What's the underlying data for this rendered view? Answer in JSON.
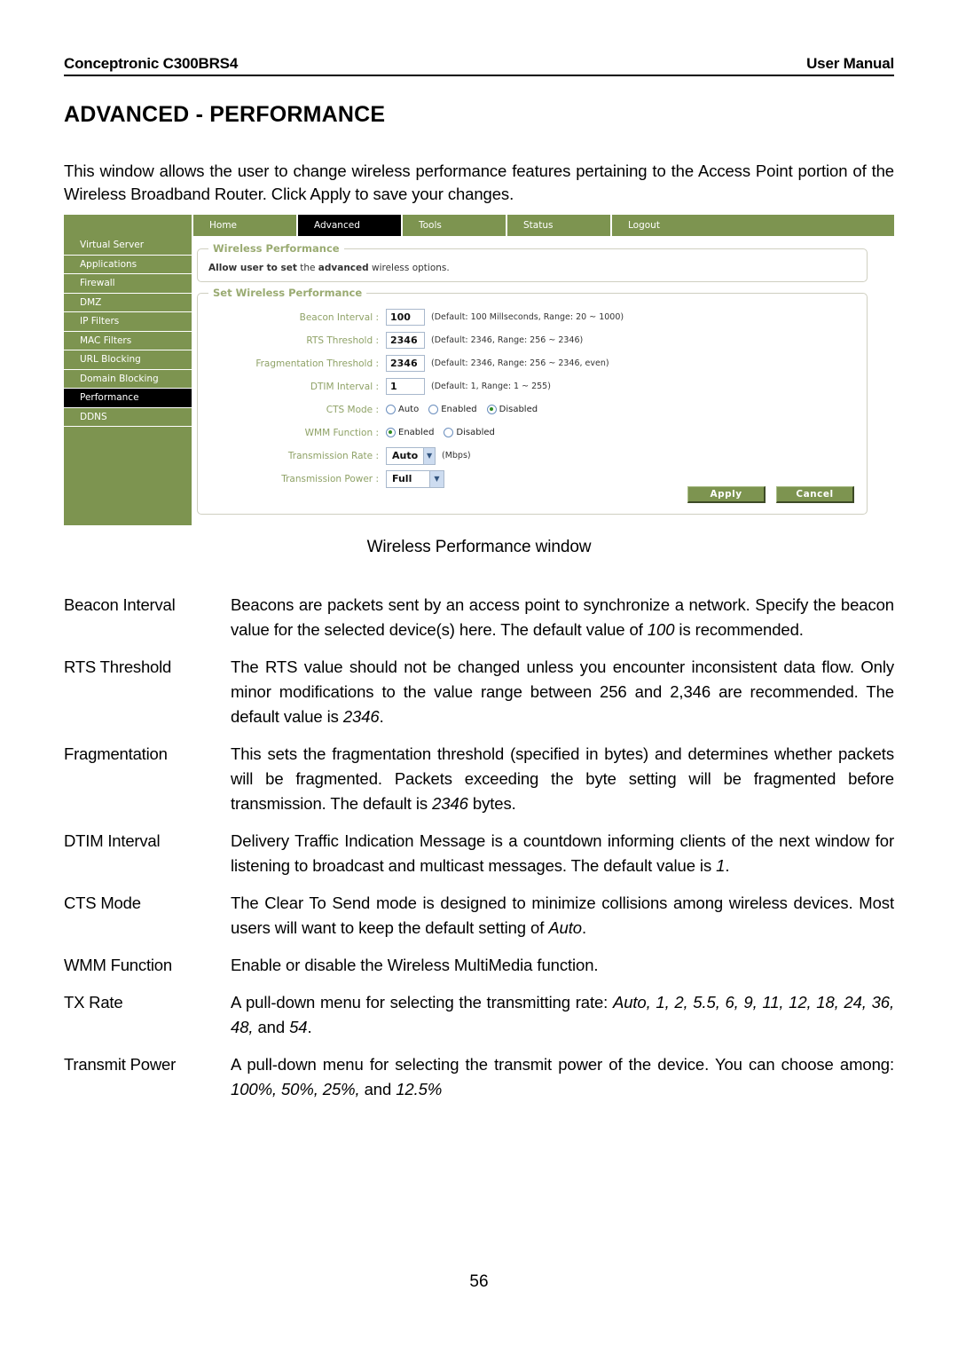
{
  "header": {
    "left": "Conceptronic C300BRS4",
    "right": "User Manual"
  },
  "section_title": "ADVANCED - PERFORMANCE",
  "intro": "This window allows the user to change wireless performance features pertaining to the Access Point portion of the Wireless Broadband Router. Click Apply to save your changes.",
  "screenshot": {
    "nav_tabs": [
      {
        "label": "Home",
        "active": false
      },
      {
        "label": "Advanced",
        "active": true
      },
      {
        "label": "Tools",
        "active": false
      },
      {
        "label": "Status",
        "active": false
      },
      {
        "label": "Logout",
        "active": false
      }
    ],
    "sidebar": [
      {
        "label": "Virtual Server",
        "active": false
      },
      {
        "label": "Applications",
        "active": false
      },
      {
        "label": "Firewall",
        "active": false
      },
      {
        "label": "DMZ",
        "active": false
      },
      {
        "label": "IP Filters",
        "active": false
      },
      {
        "label": "MAC Filters",
        "active": false
      },
      {
        "label": "URL Blocking",
        "active": false
      },
      {
        "label": "Domain Blocking",
        "active": false
      },
      {
        "label": "Performance",
        "active": true
      },
      {
        "label": "DDNS",
        "active": false
      }
    ],
    "panel_wireless": {
      "legend": "Wireless Performance",
      "description_bold_1": "Allow user to set",
      "description_normal_1": " the ",
      "description_bold_2": "advanced",
      "description_normal_2": " wireless options."
    },
    "panel_set": {
      "legend": "Set Wireless Performance",
      "fields": {
        "beacon_interval": {
          "label": "Beacon Interval :",
          "value": "100",
          "hint": "(Default: 100 Millseconds, Range: 20 ~ 1000)"
        },
        "rts_threshold": {
          "label": "RTS Threshold :",
          "value": "2346",
          "hint": "(Default: 2346, Range: 256 ~ 2346)"
        },
        "fragmentation_threshold": {
          "label": "Fragmentation Threshold :",
          "value": "2346",
          "hint": "(Default: 2346, Range: 256 ~ 2346, even)"
        },
        "dtim_interval": {
          "label": "DTIM Interval :",
          "value": "1",
          "hint": "(Default: 1, Range: 1 ~ 255)"
        },
        "cts_mode": {
          "label": "CTS Mode :",
          "options": [
            {
              "label": "Auto",
              "selected": false
            },
            {
              "label": "Enabled",
              "selected": false
            },
            {
              "label": "Disabled",
              "selected": true
            }
          ]
        },
        "wmm_function": {
          "label": "WMM Function :",
          "options": [
            {
              "label": "Enabled",
              "selected": true
            },
            {
              "label": "Disabled",
              "selected": false
            }
          ]
        },
        "transmission_rate": {
          "label": "Transmission Rate :",
          "value": "Auto",
          "unit": "(Mbps)"
        },
        "transmission_power": {
          "label": "Transmission Power :",
          "value": "Full"
        }
      },
      "apply_label": "Apply",
      "cancel_label": "Cancel"
    }
  },
  "caption": "Wireless Performance window",
  "definitions": [
    {
      "term": "Beacon Interval",
      "desc_parts": [
        {
          "text": "Beacons are packets sent by an access point to synchronize a network. Specify the beacon value for the selected device(s) here. The default value of ",
          "italic": false
        },
        {
          "text": "100",
          "italic": true
        },
        {
          "text": " is recommended.",
          "italic": false
        }
      ]
    },
    {
      "term": "RTS Threshold",
      "desc_parts": [
        {
          "text": "The RTS value should not be changed unless you encounter inconsistent data flow. Only minor modifications to the value range between 256 and 2,346 are recommended. The default value is ",
          "italic": false
        },
        {
          "text": "2346",
          "italic": true
        },
        {
          "text": ".",
          "italic": false
        }
      ]
    },
    {
      "term": "Fragmentation",
      "desc_parts": [
        {
          "text": "This sets the fragmentation threshold (specified in bytes) and determines whether packets will be fragmented. Packets exceeding the byte setting will be fragmented before transmission. The default is ",
          "italic": false
        },
        {
          "text": "2346",
          "italic": true
        },
        {
          "text": " bytes.",
          "italic": false
        }
      ]
    },
    {
      "term": "DTIM Interval",
      "desc_parts": [
        {
          "text": "Delivery Traffic Indication Message is a countdown informing clients of the next window for listening to broadcast and multicast messages. The default value is ",
          "italic": false
        },
        {
          "text": "1",
          "italic": true
        },
        {
          "text": ".",
          "italic": false
        }
      ]
    },
    {
      "term": "CTS Mode",
      "desc_parts": [
        {
          "text": "The Clear To Send mode is designed to minimize collisions among wireless devices. Most users will want to keep the default setting of ",
          "italic": false
        },
        {
          "text": "Auto",
          "italic": true
        },
        {
          "text": ".",
          "italic": false
        }
      ]
    },
    {
      "term": "WMM Function",
      "desc_parts": [
        {
          "text": "Enable or disable the Wireless MultiMedia function.",
          "italic": false
        }
      ]
    },
    {
      "term": "TX Rate",
      "desc_parts": [
        {
          "text": "A pull-down menu for selecting the transmitting rate:  ",
          "italic": false
        },
        {
          "text": "Auto, 1, 2, 5.5, 6, 9, 11, 12, 18, 24, 36, 48,",
          "italic": true
        },
        {
          "text": " and ",
          "italic": false
        },
        {
          "text": "54",
          "italic": true
        },
        {
          "text": ".",
          "italic": false
        }
      ]
    },
    {
      "term": "Transmit Power",
      "desc_parts": [
        {
          "text": "A pull-down menu for selecting the transmit power of the device. You can choose among: ",
          "italic": false
        },
        {
          "text": "100%, 50%, 25%,",
          "italic": true
        },
        {
          "text": " and ",
          "italic": false
        },
        {
          "text": "12.5%",
          "italic": true
        }
      ]
    }
  ],
  "page_number": "56"
}
